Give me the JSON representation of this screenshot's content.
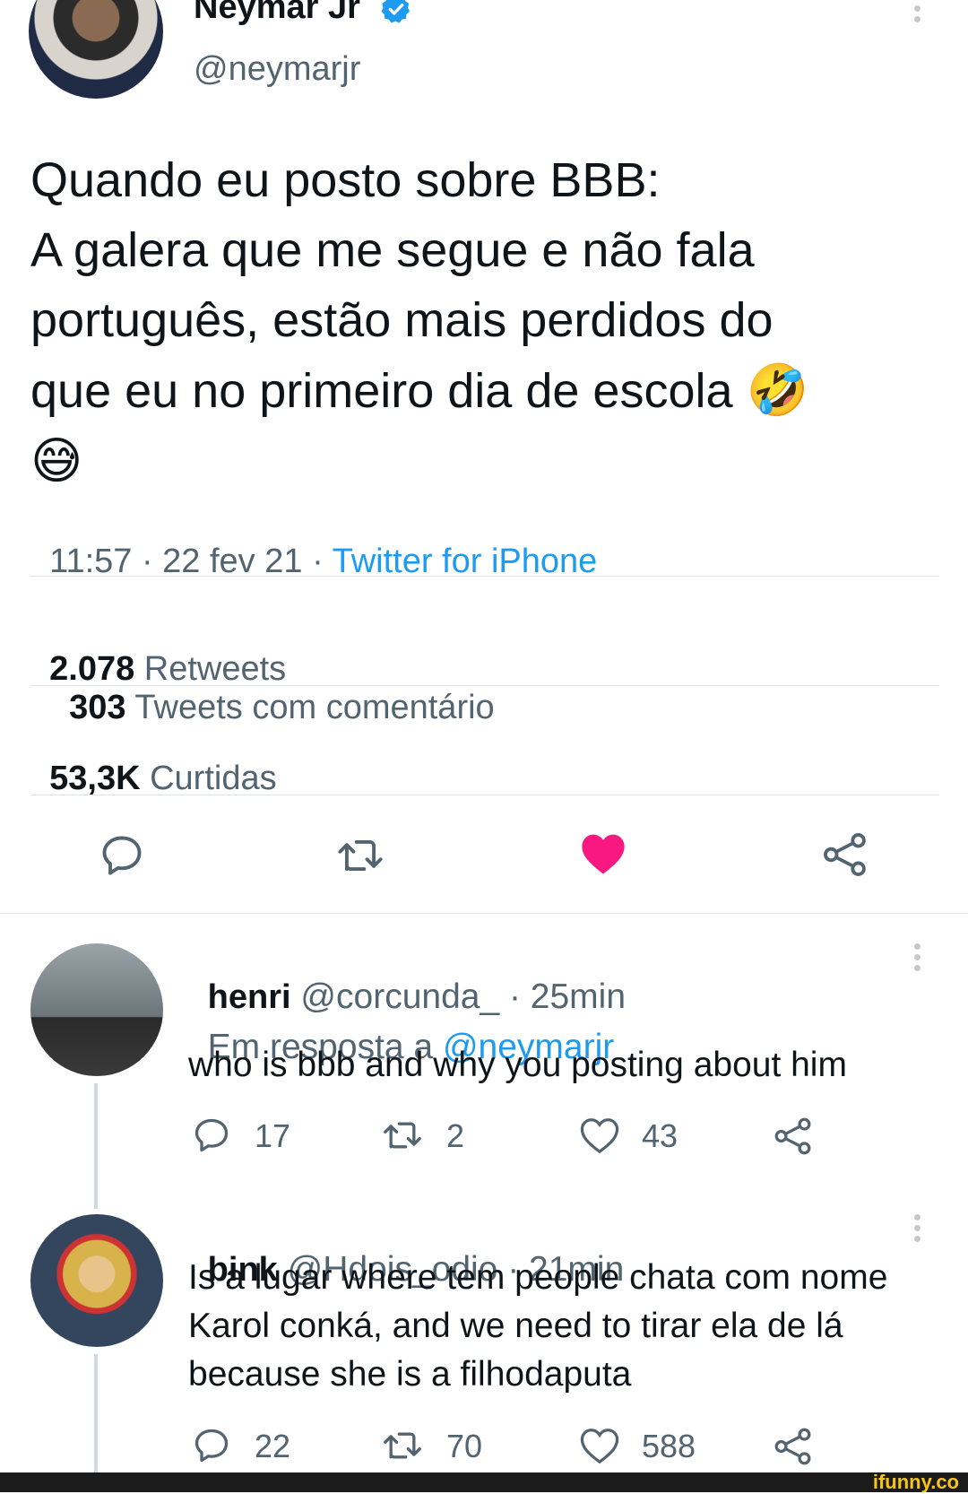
{
  "tweet": {
    "author_name": "Neymar Jr",
    "author_handle": "@neymarjr",
    "text_lines": [
      "Quando eu posto sobre BBB:",
      "A galera que me segue e não fala",
      "português, estão mais perdidos do",
      "que eu no primeiro dia de escola"
    ],
    "emoji_1": "🤣",
    "emoji_2": "😅",
    "timestamp": "11:57 · 22 fev 21 · ",
    "source": "Twitter for iPhone",
    "retweets_count": "2.078",
    "retweets_label": "Retweets",
    "quotes_count": "303",
    "quotes_label": "Tweets com comentário",
    "likes_count": "53,3K",
    "likes_label": "Curtidas",
    "liked": true
  },
  "replies": [
    {
      "name": "henri",
      "handle": "@corcunda_",
      "time": " · 25min",
      "reply_prefix": "Em resposta a ",
      "reply_to": "@neymarjr",
      "text_lines": [
        "who is bbb and why you posting about him"
      ],
      "replies": "17",
      "retweets": "2",
      "likes": "43"
    },
    {
      "name": "bink",
      "handle": "@Hdois_odio",
      "time": " · 21min",
      "text_lines": [
        "Is a lugar where tem people chata com nome",
        "Karol conká, and we need to tirar ela de lá",
        "because she is a filhodaputa"
      ],
      "replies": "22",
      "retweets": "70",
      "likes": "588"
    }
  ],
  "watermark": "ifunny.co",
  "colors": {
    "link": "#1d9bf0",
    "like": "#f91880",
    "muted": "#536471",
    "text": "#0f1419"
  },
  "icons": {
    "verified": "verified-badge-icon",
    "reply": "reply-icon",
    "retweet": "retweet-icon",
    "like": "heart-icon",
    "share": "share-icon",
    "more": "more-options-icon"
  }
}
